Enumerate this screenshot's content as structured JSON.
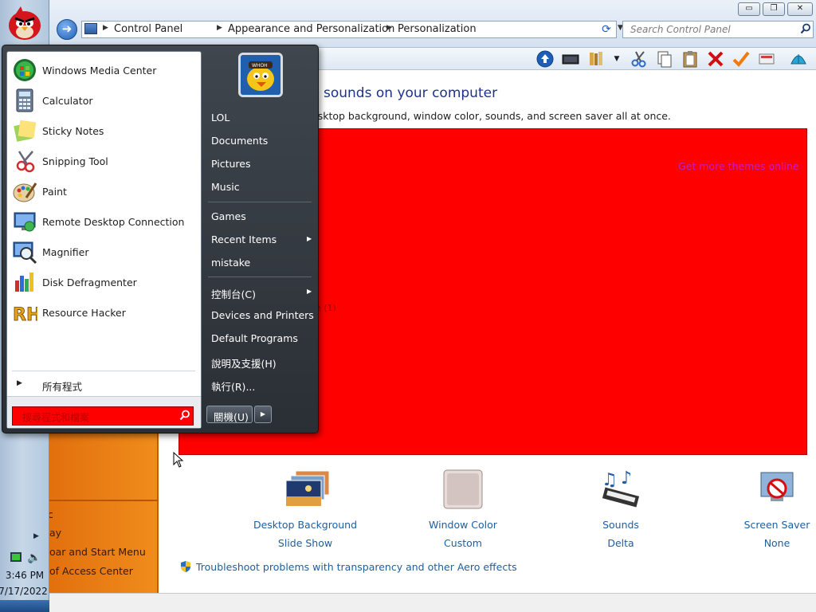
{
  "window": {
    "caption_buttons": {
      "minimize": "▭",
      "maximize": "❐",
      "close": "✕"
    },
    "breadcrumb": [
      "Control Panel",
      "Appearance and Personalization",
      "Personalization"
    ],
    "search_placeholder": "Search Control Panel"
  },
  "content": {
    "title": "sounds on your computer",
    "description": "esktop background, window color, sounds, and screen saver all at once.",
    "more_themes_link": "Get more themes online",
    "hidden_fragment": "e (1)",
    "items": [
      {
        "name": "Desktop Background",
        "value": "Slide Show"
      },
      {
        "name": "Window Color",
        "value": "Custom"
      },
      {
        "name": "Sounds",
        "value": "Delta"
      },
      {
        "name": "Screen Saver",
        "value": "None"
      }
    ],
    "troubleshoot_link": "Troubleshoot problems with transparency and other Aero effects"
  },
  "navpane": {
    "links": [
      "ay",
      "oar and Start Menu",
      "of Access Center"
    ]
  },
  "start_menu": {
    "programs": [
      "Windows Media Center",
      "Calculator",
      "Sticky Notes",
      "Snipping Tool",
      "Paint",
      "Remote Desktop Connection",
      "Magnifier",
      "Disk Defragmenter",
      "Resource Hacker"
    ],
    "all_programs": "所有程式",
    "search_placeholder": "搜尋程式和檔案",
    "right_items": [
      {
        "label": "LOL",
        "submenu": false
      },
      {
        "label": "Documents",
        "submenu": false
      },
      {
        "label": "Pictures",
        "submenu": false
      },
      {
        "label": "Music",
        "submenu": false
      },
      {
        "label": "Games",
        "submenu": false
      },
      {
        "label": "Recent Items",
        "submenu": true
      },
      {
        "label": "mistake",
        "submenu": false
      },
      {
        "label": "控制台(C)",
        "submenu": true
      },
      {
        "label": "Devices and Printers",
        "submenu": false
      },
      {
        "label": "Default Programs",
        "submenu": false
      },
      {
        "label": "說明及支援(H)",
        "submenu": false
      },
      {
        "label": "執行(R)...",
        "submenu": false
      }
    ],
    "shutdown": "關機(U)",
    "arrow_glyph": "▶"
  },
  "taskbar": {
    "time": "3:46 PM",
    "date": "7/17/2022",
    "tray_arrow": "▶"
  },
  "icons": {
    "back": "➜",
    "refresh": "⟳",
    "search": "⚲",
    "dropdown": "▼",
    "crumb_sep": "▶"
  },
  "colors": {
    "theme_area": "#ff0000",
    "navpane": "#f08c1c",
    "start_search": "#ff0000",
    "link": "#1e5e9e"
  }
}
